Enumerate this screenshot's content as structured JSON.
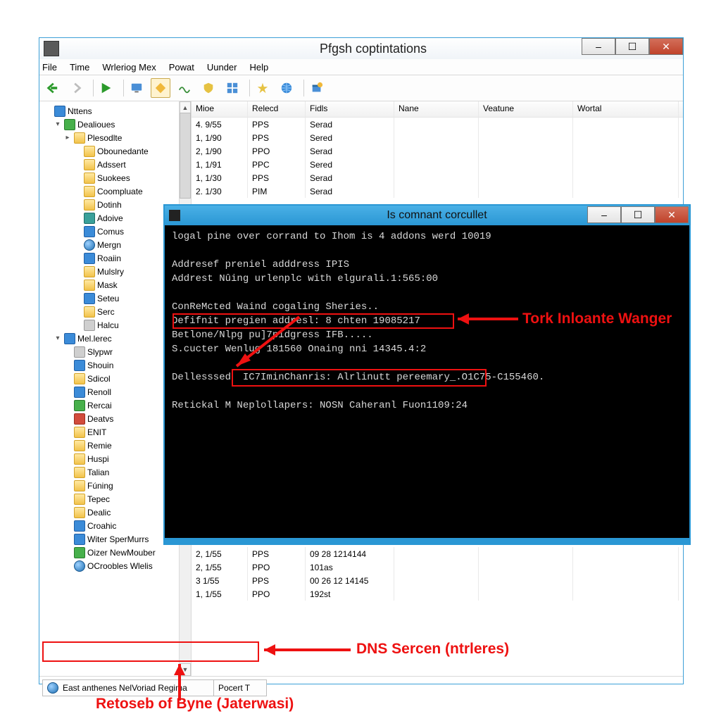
{
  "main_window": {
    "title": "Pfgsh coptintations",
    "menu": [
      "File",
      "Time",
      "Wrleriog Mex",
      "Powat",
      "Uunder",
      "Help"
    ],
    "toolbar_icons": [
      "back-arrow-icon",
      "forward-arrow-icon",
      "play-icon",
      "monitor-icon",
      "diamond-icon",
      "wave-icon",
      "shield-icon",
      "tiles-icon",
      "favorites-icon",
      "globe-icon",
      "new-window-icon"
    ]
  },
  "tree": {
    "root": "Nttens",
    "group1": {
      "label": "Dealioues",
      "items": [
        "Plesodlte",
        "Obounedante",
        "Adssert",
        "Suokees",
        "Coompluate",
        "Dotinh",
        "Adoive",
        "Comus",
        "Mergn",
        "Roaiin",
        "Mulslry",
        "Mask",
        "Seteu",
        "Serc",
        "Halcu"
      ]
    },
    "group2": {
      "label": "Mel.lerec",
      "items": [
        "Slypwr",
        "Shouin",
        "Sdicol",
        "Renoll",
        "Rercai",
        "Deatvs",
        "ENIT",
        "Remie",
        "Huspi",
        "Talian",
        "Fúning",
        "Tepec",
        "Dealic",
        "Croahic",
        "Witer SperMurrs",
        "Oizer NewMouber",
        "OCroobles Wlelis"
      ]
    }
  },
  "list": {
    "headers": [
      "Mioe",
      "Relecd",
      "Fidls",
      "Nane",
      "Veatune",
      "Wortal"
    ],
    "rows_top": [
      [
        "4. 9/55",
        "PPS",
        "Serad",
        "",
        "",
        ""
      ],
      [
        "1, 1/90",
        "PPS",
        "Sered",
        "",
        "",
        ""
      ],
      [
        "2, 1/90",
        "PPO",
        "Serad",
        "",
        "",
        ""
      ],
      [
        "1, 1/91",
        "PPC",
        "Sered",
        "",
        "",
        ""
      ],
      [
        "1, 1/30",
        "PPS",
        "Serad",
        "",
        "",
        ""
      ],
      [
        "2. 1/30",
        "PIM",
        "Serad",
        "",
        "",
        ""
      ]
    ],
    "rows_bot": [
      [
        "2, 1/55",
        "PPS",
        "09 28 1214144",
        "",
        "",
        ""
      ],
      [
        "2, 1/55",
        "PPO",
        "101as",
        "",
        "",
        ""
      ],
      [
        "3   1/55",
        "PPS",
        "00 26 12 14145",
        "",
        "",
        ""
      ],
      [
        "1, 1/55",
        "PPO",
        "192st",
        "",
        "",
        ""
      ]
    ]
  },
  "statusbar": {
    "cell1": "East anthenes NelVoriad Regima",
    "cell2": "Pocert T"
  },
  "console": {
    "title": "Is comnant corcullet",
    "lines": [
      "logal pine over corrand to Ihom is 4 addons werd 10019",
      "",
      "Addresef preniel adddress IPIS",
      "Addrest Nûing urlenplc with elgurali.1:565:00",
      "",
      "ConReMcted Waind cogaling Sheries..",
      "Defifnit pregien addresl: 8 chten 19085217",
      "Betlone/Nlpg pu]7pidgress IFB.....",
      "S.cucter Wenlug 181560 Onaing nni 14345.4:2",
      "",
      "Dellesssed  IC7IminChanris: Alrlinutt pereemary_.O1C75-C155460.",
      "",
      "Retickal M Neplollapers: NOSN Caheranl Fuon1109:24"
    ]
  },
  "annotations": {
    "a1": "Tork Inloante Wanger",
    "a2": "DNS Sercen (ntrleres)",
    "a3": "Retoseb of Byne (Jaterwasi)"
  },
  "colors": {
    "accent": "#2a97d4",
    "highlight": "#e11"
  }
}
